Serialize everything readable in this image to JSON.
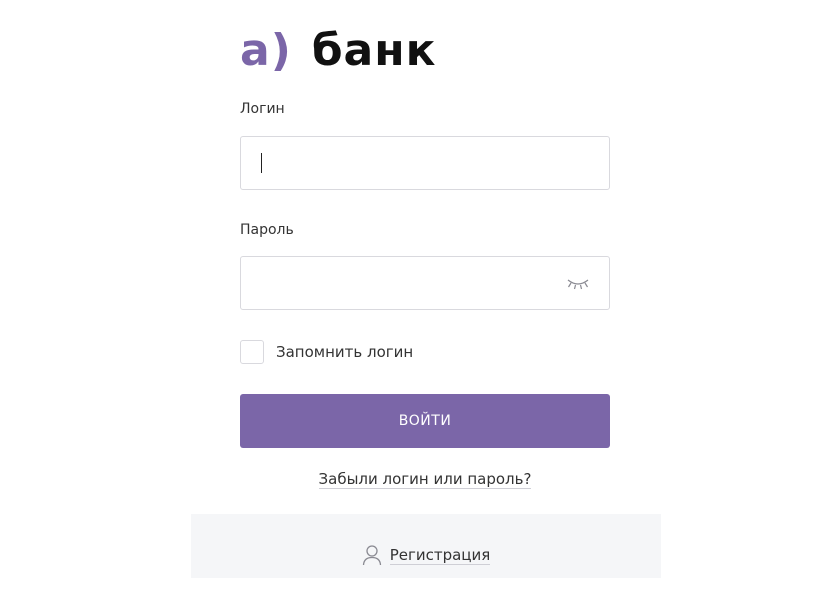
{
  "brand": {
    "logo_mark": "а)",
    "logo_text": "банк",
    "accent_color": "#7b66a8"
  },
  "login_form": {
    "login_label": "Логин",
    "login_value": "",
    "password_label": "Пароль",
    "password_value": "",
    "password_toggle_icon": "eye-closed-icon",
    "remember_label": "Запомнить логин",
    "remember_checked": false,
    "submit_label": "ВОЙТИ",
    "forgot_link": "Забыли логин или пароль?"
  },
  "footer": {
    "register_icon": "user-icon",
    "register_label": "Регистрация"
  }
}
